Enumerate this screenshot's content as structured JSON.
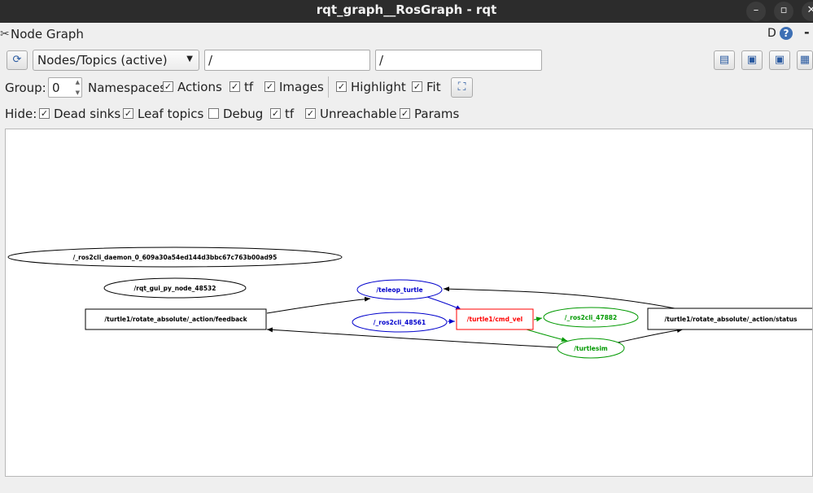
{
  "window": {
    "title": "rqt_graph__RosGraph - rqt"
  },
  "dock": {
    "title": "Node Graph",
    "d_label": "D",
    "help_label": "?",
    "dash_label": "-"
  },
  "toolbar": {
    "view_mode": "Nodes/Topics (active)",
    "filter_include": "/",
    "filter_exclude": "/"
  },
  "options": {
    "group_label": "Group:",
    "group_value": "0",
    "namespaces_label": "Namespaces",
    "actions": {
      "label": "Actions",
      "checked": true
    },
    "tf": {
      "label": "tf",
      "checked": true
    },
    "images": {
      "label": "Images",
      "checked": true
    },
    "highlight": {
      "label": "Highlight",
      "checked": true
    },
    "fit": {
      "label": "Fit",
      "checked": true
    }
  },
  "hide": {
    "label": "Hide:",
    "dead_sinks": {
      "label": "Dead sinks",
      "checked": true
    },
    "leaf_topics": {
      "label": "Leaf topics",
      "checked": true
    },
    "debug": {
      "label": "Debug",
      "checked": false
    },
    "tf": {
      "label": "tf",
      "checked": true
    },
    "unreachable": {
      "label": "Unreachable",
      "checked": true
    },
    "params": {
      "label": "Params",
      "checked": true
    }
  },
  "graph": {
    "nodes": {
      "daemon": "/_ros2cli_daemon_0_609a30a54ed144d3bbc67c763b00ad95",
      "rqt_gui": "/rqt_gui_py_node_48532",
      "teleop": "/teleop_turtle",
      "ros2cli_48561": "/_ros2cli_48561",
      "ros2cli_47882": "/_ros2cli_47882",
      "turtlesim": "/turtlesim"
    },
    "topics": {
      "feedback": "/turtle1/rotate_absolute/_action/feedback",
      "cmd_vel": "/turtle1/cmd_vel",
      "status": "/turtle1/rotate_absolute/_action/status"
    },
    "colors": {
      "default": "#000000",
      "publisher": "#0000cc",
      "topic": "#ff0000",
      "subscriber": "#009900"
    }
  },
  "icons": {
    "refresh": "refresh-icon",
    "save": "save-icon",
    "load": "load-icon",
    "export": "export-icon",
    "image": "image-icon",
    "fit": "fit-view-icon",
    "help": "help-icon",
    "dock": "dock-icon"
  }
}
